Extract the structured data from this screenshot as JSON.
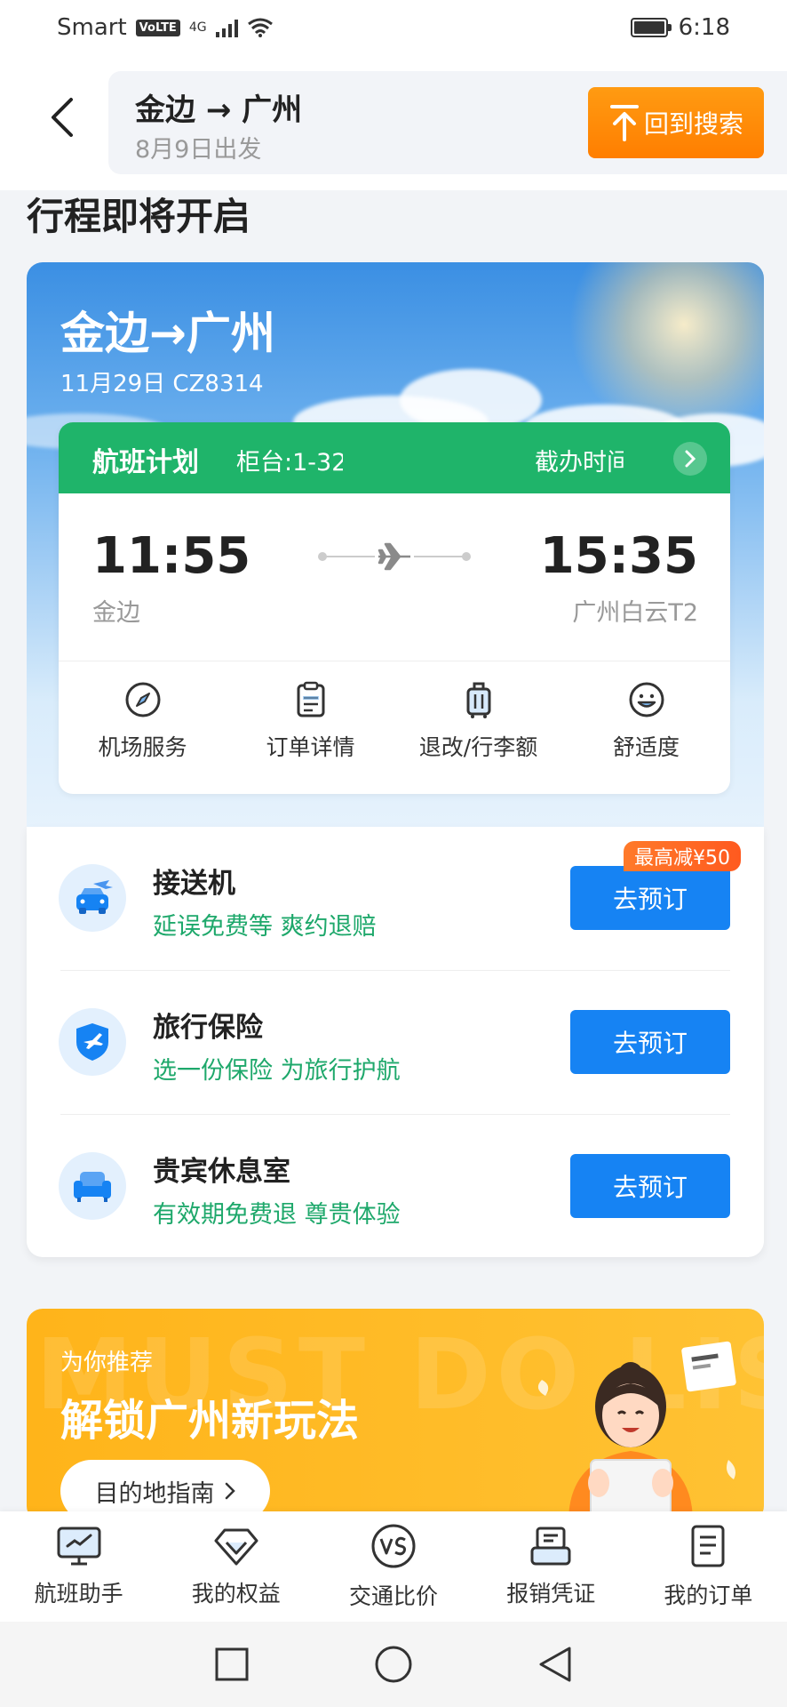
{
  "status_bar": {
    "carrier": "Smart",
    "volte": "VoLTE",
    "network": "4G",
    "time": "6:18"
  },
  "header": {
    "route": "金边 → 广州",
    "date": "8月9日出发",
    "back_search_label": "回到搜索"
  },
  "section_title": "行程即将开启",
  "trip": {
    "route": "金边→广州",
    "subtitle": "11月29日 CZ8314",
    "plan_title": "航班计划",
    "plan_counter": "柜台:1-32",
    "plan_deadline": "截办时间",
    "departure_time": "11:55",
    "departure_city": "金边",
    "arrival_time": "15:35",
    "arrival_city": "广州白云T2",
    "services": [
      {
        "label": "机场服务",
        "icon": "compass-icon"
      },
      {
        "label": "订单详情",
        "icon": "clipboard-icon"
      },
      {
        "label": "退改/行李额",
        "icon": "luggage-icon"
      },
      {
        "label": "舒适度",
        "icon": "smiley-icon"
      }
    ]
  },
  "bookings": [
    {
      "title": "接送机",
      "subtitle": "延误免费等 爽约退赔",
      "button": "去预订",
      "badge": "最高减¥50",
      "icon": "car-icon"
    },
    {
      "title": "旅行保险",
      "subtitle": "选一份保险 为旅行护航",
      "button": "去预订",
      "icon": "shield-icon"
    },
    {
      "title": "贵宾休息室",
      "subtitle": "有效期免费退 尊贵体验",
      "button": "去预订",
      "icon": "sofa-icon"
    }
  ],
  "recommend": {
    "small": "为你推荐",
    "big": "解锁广州新玩法",
    "button": "目的地指南",
    "watermark": "MUST DO LIST"
  },
  "bottom_nav": [
    {
      "label": "航班助手",
      "icon": "monitor-icon"
    },
    {
      "label": "我的权益",
      "icon": "diamond-icon"
    },
    {
      "label": "交通比价",
      "icon": "vs-icon"
    },
    {
      "label": "报销凭证",
      "icon": "receipt-icon"
    },
    {
      "label": "我的订单",
      "icon": "order-icon"
    }
  ],
  "colors": {
    "accent_green": "#1fb46a",
    "accent_blue": "#1683f3",
    "accent_orange": "#ff8a00",
    "text_green": "#1ea86b"
  }
}
